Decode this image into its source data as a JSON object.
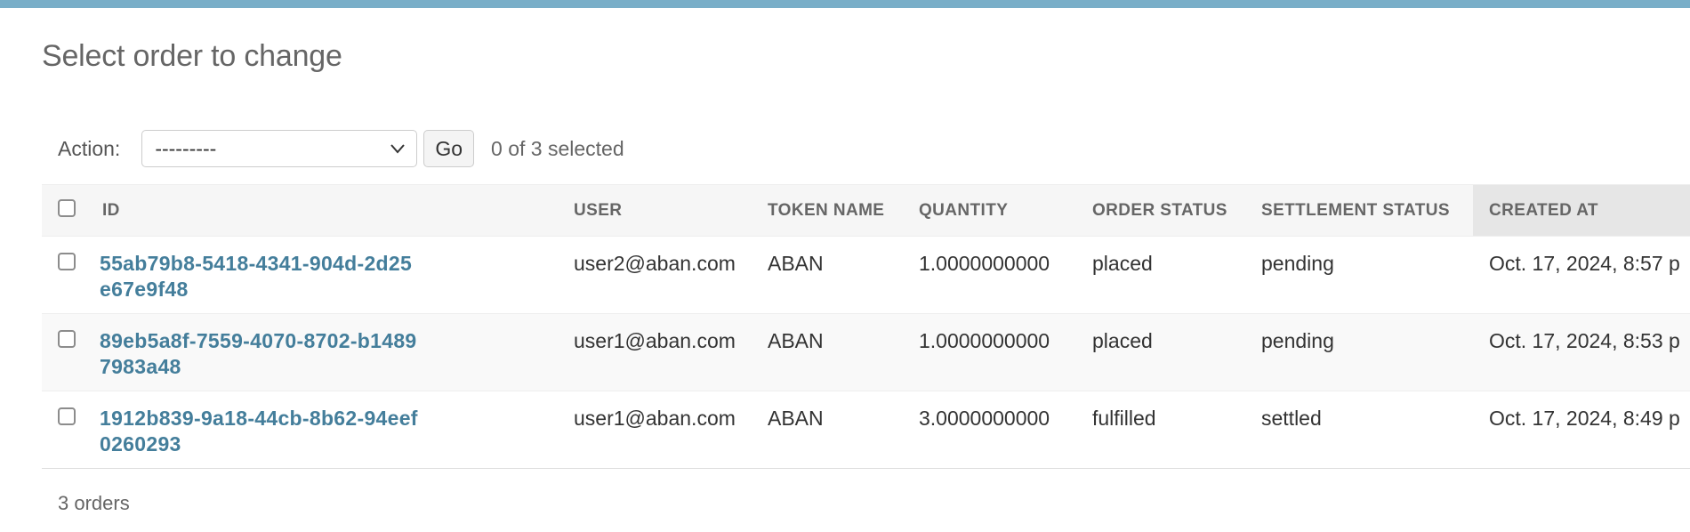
{
  "colors": {
    "top_bar": "#79aec8",
    "link": "#447e9b",
    "sorted_header_bg": "#e6e6e6"
  },
  "page": {
    "title": "Select order to change"
  },
  "actions": {
    "label": "Action:",
    "select_value": "---------",
    "go_label": "Go",
    "selected_count": "0 of 3 selected"
  },
  "table": {
    "headers": {
      "id": "ID",
      "user": "USER",
      "token_name": "TOKEN NAME",
      "quantity": "QUANTITY",
      "order_status": "ORDER STATUS",
      "settlement_status": "SETTLEMENT STATUS",
      "created_at": "CREATED AT"
    },
    "rows": [
      {
        "id": "55ab79b8-5418-4341-904d-2d25e67e9f48",
        "user": "user2@aban.com",
        "token_name": "ABAN",
        "quantity": "1.0000000000",
        "order_status": "placed",
        "settlement_status": "pending",
        "created_at": "Oct. 17, 2024, 8:57 p"
      },
      {
        "id": "89eb5a8f-7559-4070-8702-b14897983a48",
        "user": "user1@aban.com",
        "token_name": "ABAN",
        "quantity": "1.0000000000",
        "order_status": "placed",
        "settlement_status": "pending",
        "created_at": "Oct. 17, 2024, 8:53 p"
      },
      {
        "id": "1912b839-9a18-44cb-8b62-94eef0260293",
        "user": "user1@aban.com",
        "token_name": "ABAN",
        "quantity": "3.0000000000",
        "order_status": "fulfilled",
        "settlement_status": "settled",
        "created_at": "Oct. 17, 2024, 8:49 p"
      }
    ]
  },
  "paginator": {
    "text": "3 orders"
  },
  "icons": {
    "select_arrow": "chevron-down-icon",
    "checkbox": "checkbox-icon"
  }
}
